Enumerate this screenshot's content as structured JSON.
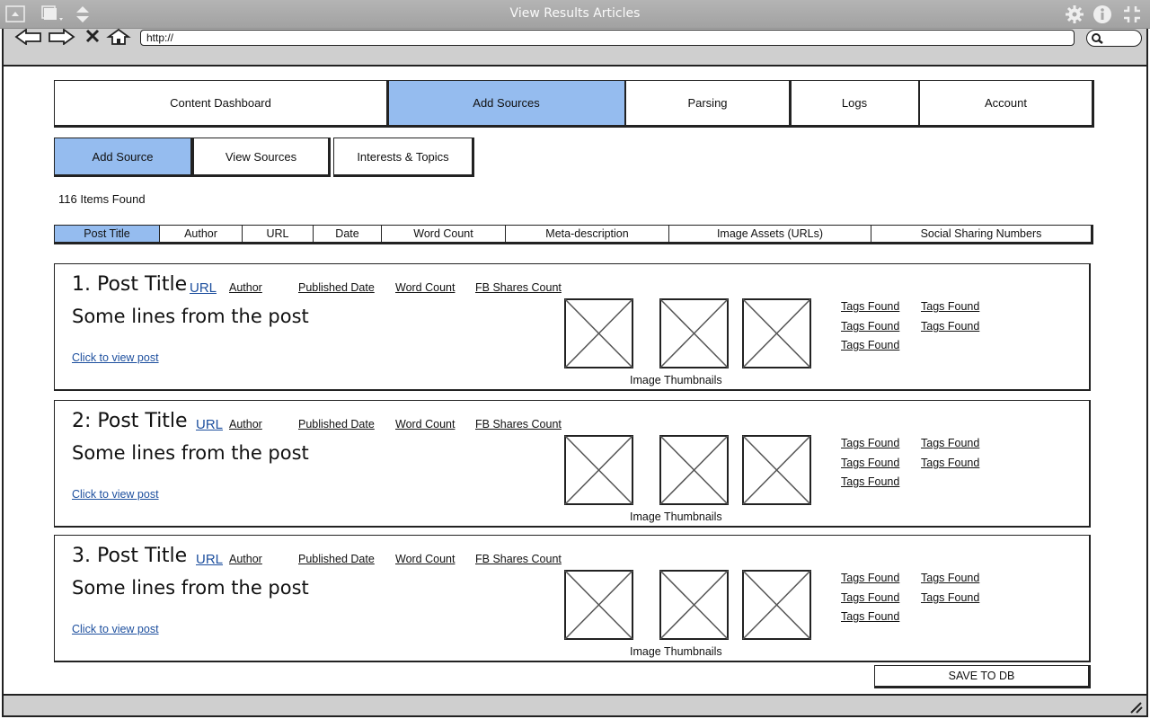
{
  "window": {
    "title": "View Results Articles"
  },
  "browser": {
    "url": "http://"
  },
  "main_tabs": [
    {
      "label": "Content Dashboard",
      "active": false
    },
    {
      "label": "Add Sources",
      "active": true
    },
    {
      "label": "Parsing",
      "active": false
    },
    {
      "label": "Logs",
      "active": false
    },
    {
      "label": "Account",
      "active": false
    }
  ],
  "sub_tabs": [
    {
      "label": "Add Source",
      "active": true
    },
    {
      "label": "View Sources",
      "active": false
    },
    {
      "label": "Interests & Topics",
      "active": false
    }
  ],
  "items_found": "116 Items Found",
  "columns": [
    {
      "label": "Post Title",
      "active": true
    },
    {
      "label": "Author",
      "active": false
    },
    {
      "label": "URL",
      "active": false
    },
    {
      "label": "Date",
      "active": false
    },
    {
      "label": "Word Count",
      "active": false
    },
    {
      "label": "Meta-description",
      "active": false
    },
    {
      "label": "Image Assets (URLs)",
      "active": false
    },
    {
      "label": "Social Sharing Numbers",
      "active": false
    }
  ],
  "results": [
    {
      "title": "1. Post Title",
      "url_label": "URL",
      "author": "Author",
      "published_date": "Published Date",
      "word_count": "Word Count",
      "fb_shares": "FB Shares Count",
      "excerpt": "Some lines from the post",
      "view_link": "Click to view post",
      "thumbnails_caption": "Image Thumbnails",
      "tags": [
        "Tags Found",
        "Tags Found",
        "Tags Found",
        "Tags Found",
        "Tags Found"
      ]
    },
    {
      "title": "2: Post Title",
      "url_label": "URL",
      "author": "Author",
      "published_date": "Published Date",
      "word_count": "Word Count",
      "fb_shares": "FB Shares Count",
      "excerpt": "Some lines from the post",
      "view_link": "Click to view post",
      "thumbnails_caption": "Image Thumbnails",
      "tags": [
        "Tags Found",
        "Tags Found",
        "Tags Found",
        "Tags Found",
        "Tags Found"
      ]
    },
    {
      "title": "3. Post Title",
      "url_label": "URL",
      "author": "Author",
      "published_date": "Published Date",
      "word_count": "Word Count",
      "fb_shares": "FB Shares Count",
      "excerpt": "Some lines from the post",
      "view_link": "Click to view post",
      "thumbnails_caption": "Image Thumbnails",
      "tags": [
        "Tags Found",
        "Tags Found",
        "Tags Found",
        "Tags Found",
        "Tags Found"
      ]
    }
  ],
  "save_button": "SAVE TO DB",
  "colors": {
    "active_tab": "#95bcef",
    "link": "#1d4f9e",
    "chrome": "#cfcfcf"
  }
}
